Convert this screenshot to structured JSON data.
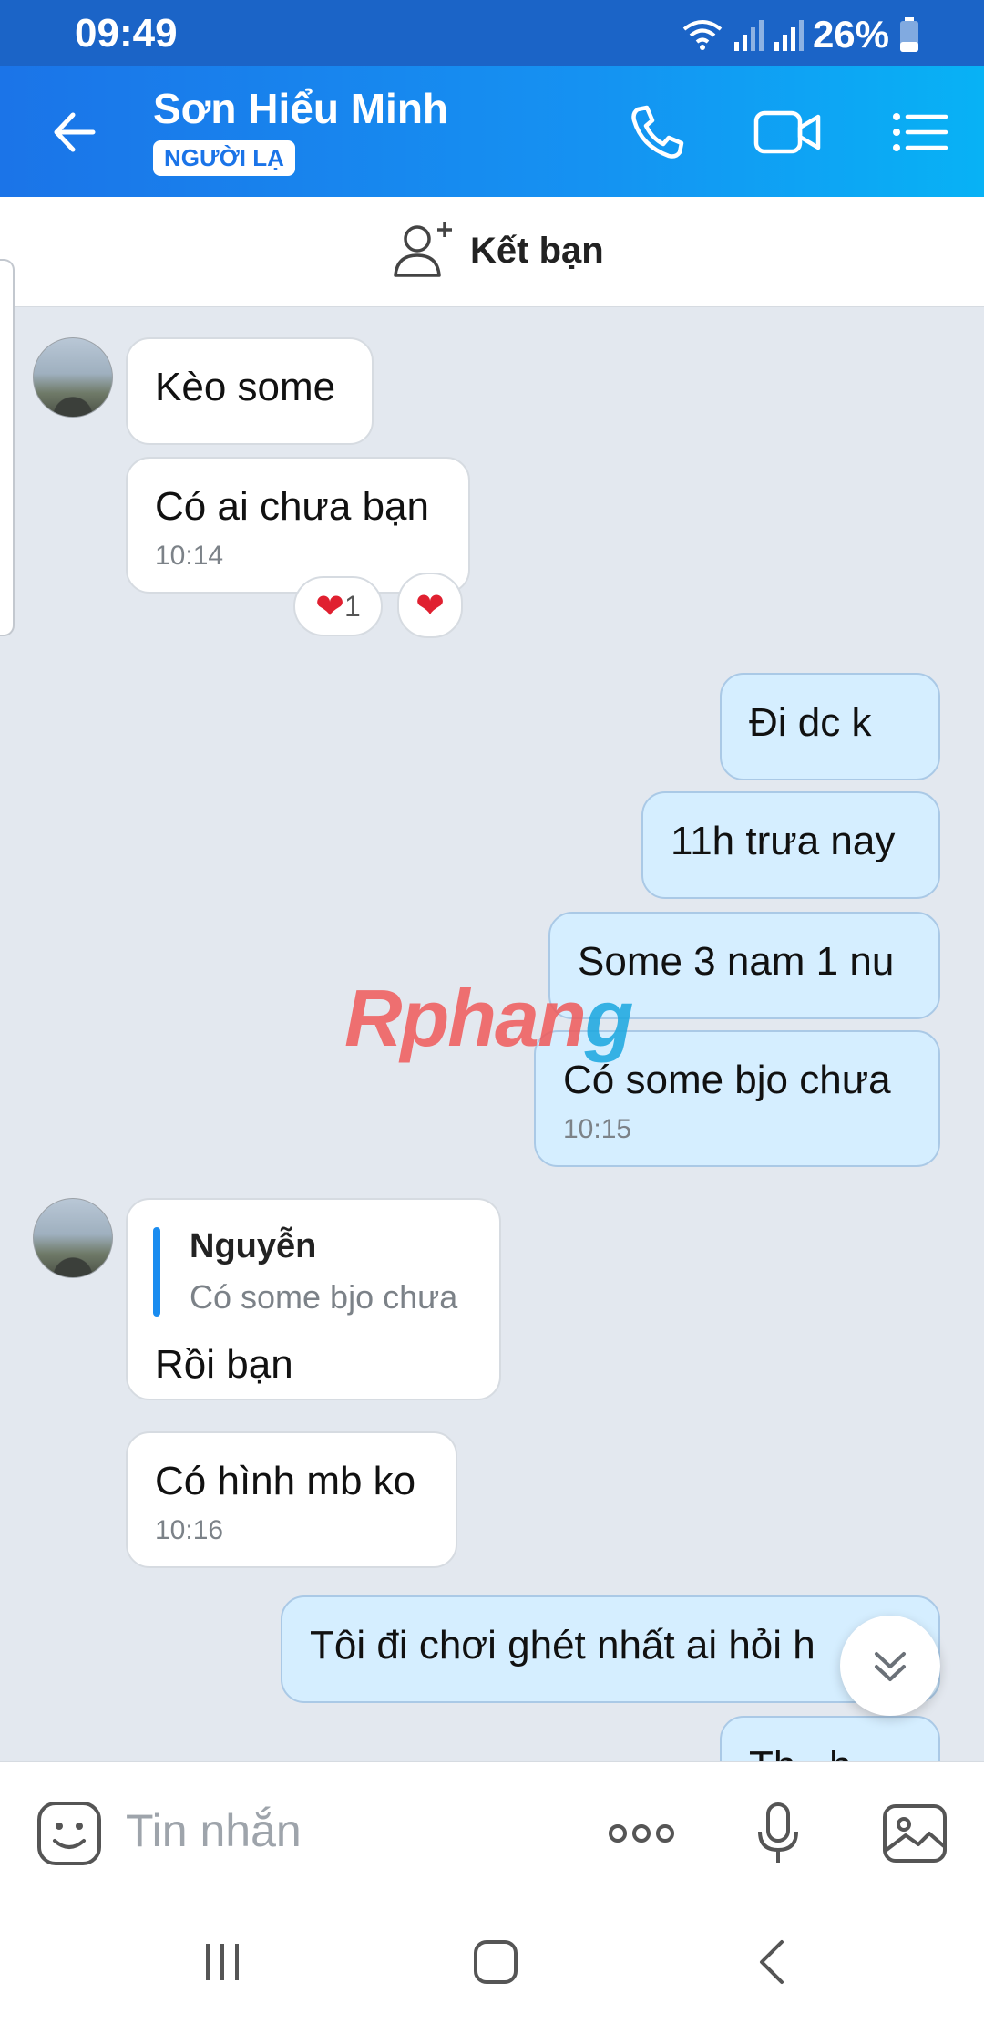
{
  "status_bar": {
    "time": "09:49",
    "battery": "26%"
  },
  "header": {
    "contact_name": "Sơn Hiểu Minh",
    "badge": "NGƯỜI LẠ"
  },
  "add_friend": {
    "label": "Kết bạn"
  },
  "messages": [
    {
      "side": "in",
      "text": "Kèo some"
    },
    {
      "side": "in",
      "text": "Có ai chưa bạn",
      "time": "10:14",
      "reactions": {
        "count": "1"
      }
    },
    {
      "side": "out",
      "text": "Đi dc k"
    },
    {
      "side": "out",
      "text": "11h trưa nay"
    },
    {
      "side": "out",
      "text": "Some 3 nam 1 nu"
    },
    {
      "side": "out",
      "text": "Có some bjo chưa",
      "time": "10:15"
    },
    {
      "side": "in",
      "quote": {
        "author": "Nguyễn",
        "text": "Có some bjo chưa"
      },
      "text": "Rồi bạn"
    },
    {
      "side": "in",
      "text": "Có hình mb ko",
      "time": "10:16"
    },
    {
      "side": "out",
      "text": "Tôi đi chơi ghét nhất ai hỏi h"
    },
    {
      "side": "out",
      "text": "Th...h"
    }
  ],
  "watermark": {
    "part1": "Rphan",
    "part2": "g"
  },
  "composer": {
    "placeholder": "Tin nhắn"
  },
  "colors": {
    "header_start": "#1b74e8",
    "header_end": "#08b2f5",
    "out_bubble": "#d5eeff",
    "accent": "#1a8cf0"
  }
}
